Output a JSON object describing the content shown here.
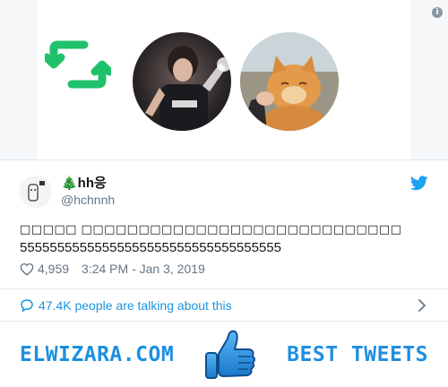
{
  "media": {
    "info_icon": "info-icon",
    "retweet_icon": "retweet-icon",
    "image_1": "person-photo",
    "image_2": "cat-photo",
    "retweet_color": "#1fc26b"
  },
  "tweet": {
    "display_name": "🎄hh응",
    "screen_name": "@hchnnh",
    "text_line1": "□□□□□ □□□□□□□□□□□□□□□□□□□□□□□□□□□□",
    "text_line2": "55555555555555555555555555555555555",
    "likes": "4,959",
    "timestamp": "3:24 PM - Jan 3, 2019",
    "heart_icon": "heart-icon",
    "brand_icon": "twitter-bird-icon",
    "brand_color": "#1da1f2"
  },
  "conversation": {
    "label": "47.4K people are talking about this",
    "icon": "speech-bubble-icon",
    "chevron": "chevron-right-icon",
    "link_color": "#1b95e0"
  },
  "banner": {
    "left_text": "ELWIZARA.COM",
    "right_text": "BEST TWEETS",
    "icon": "thumbs-up-icon",
    "accent": "#1d8fe0"
  }
}
